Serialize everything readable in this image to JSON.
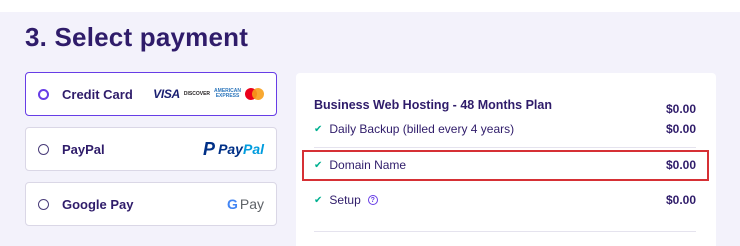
{
  "title": "3. Select payment",
  "payment_methods": [
    {
      "label": "Credit Card",
      "selected": true
    },
    {
      "label": "PayPal",
      "selected": false
    },
    {
      "label": "Google Pay",
      "selected": false
    }
  ],
  "card_logos": {
    "visa": "VISA",
    "discover": "DISCOVER",
    "amex_top": "AMERICAN",
    "amex_bottom": "EXPRESS",
    "mastercard": "mastercard-icon"
  },
  "paypal_logo": {
    "text_a": "Pay",
    "text_b": "Pal"
  },
  "gpay_logo": {
    "g": "G",
    "pay": "Pay"
  },
  "summary": {
    "plan": {
      "label": "Business Web Hosting - 48 Months Plan",
      "amount": "$0.00"
    },
    "items": [
      {
        "label": "Daily Backup (billed every 4 years)",
        "amount": "$0.00"
      },
      {
        "label": "Domain Name",
        "amount": "$0.00"
      },
      {
        "label": "Setup",
        "amount": "$0.00"
      }
    ]
  },
  "colors": {
    "accent": "#673de6",
    "heading": "#2f1c6a",
    "check": "#00b090",
    "highlight": "#d63035"
  }
}
